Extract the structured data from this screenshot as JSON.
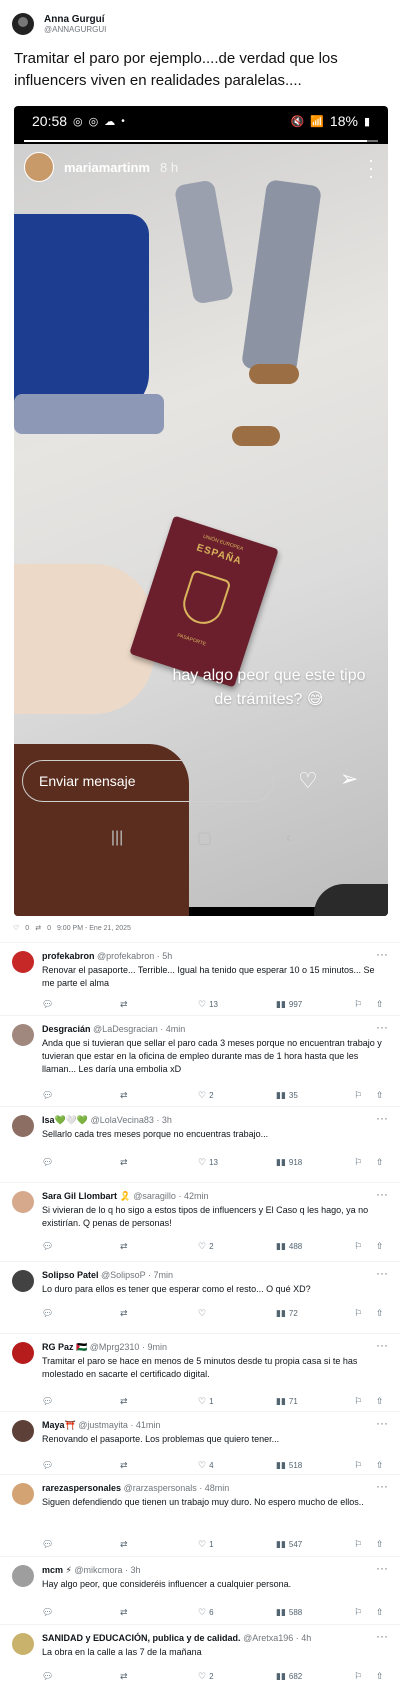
{
  "post": {
    "author_name": "Anna Gurguí",
    "author_handle": "@ANNAGURGUI",
    "text": "Tramitar el paro por ejemplo....de verdad que los influencers viven en realidades paralelas....",
    "meta": {
      "likes": "0",
      "retweets": "0",
      "datetime": "9:00 PM - Ene 21, 2025"
    }
  },
  "story": {
    "status_time": "20:58",
    "battery": "18%",
    "progress": 0.97,
    "username": "mariamartinm",
    "time": "8 h",
    "caption": "hay algo peor que este tipo de trámites? 😅",
    "message_placeholder": "Enviar mensaje",
    "passport_top": "UNIÓN EUROPEA",
    "passport_country": "ESPAÑA",
    "passport_bottom": "PASAPORTE"
  },
  "replies": [
    {
      "name": "profekabron",
      "badge": "",
      "handle": "@profekabron",
      "time": "5h",
      "text": "Renovar el pasaporte... Terrible... Igual ha tenido que esperar 10 o 15 minutos... Se me parte el alma",
      "likes": "13",
      "views": "997",
      "avatar_color": "#c62828"
    },
    {
      "name": "Desgracián",
      "badge": "",
      "handle": "@LaDesgracian",
      "time": "4min",
      "text": "Anda que si tuvieran que sellar el paro cada 3 meses porque no encuentran trabajo y tuvieran que estar en la oficina de empleo durante mas de 1 hora hasta que les llaman... Les daría una embolia xD",
      "likes": "2",
      "views": "35",
      "avatar_color": "#a1887f"
    },
    {
      "name": "Isa💚🤍💚",
      "badge": "",
      "handle": "@LolaVecina83",
      "time": "3h",
      "text": "Sellarlo cada tres meses porque no encuentras trabajo...",
      "likes": "13",
      "views": "918",
      "avatar_color": "#8d6e63"
    },
    {
      "name": "Sara Gil Llombart",
      "badge": "🎗️",
      "handle": "@saragillo",
      "time": "42min",
      "text": "Si vivieran de lo q ho sigo a estos tipos de influencers y El Caso q les hago, ya no existirían. Q penas de personas!",
      "likes": "2",
      "views": "488",
      "avatar_color": "#d7a98c"
    },
    {
      "name": "Solipso Patel",
      "badge": "",
      "handle": "@SolipsoP",
      "time": "7min",
      "text": "Lo duro para ellos es tener que esperar como el resto... O qué XD?",
      "likes": "",
      "views": "72",
      "avatar_color": "#424242"
    },
    {
      "name": "RG Paz",
      "badge": "🇵🇸",
      "handle": "@Mprg2310",
      "time": "9min",
      "text": "Tramitar el paro se hace en menos de 5 minutos desde tu propia casa si te has molestado en sacarte el certificado digital.",
      "likes": "1",
      "views": "71",
      "avatar_color": "#b71c1c"
    },
    {
      "name": "Maya⛩️",
      "badge": "",
      "handle": "@justmayita",
      "time": "41min",
      "text": "Renovando el pasaporte. Los problemas que quiero tener...",
      "likes": "4",
      "views": "518",
      "avatar_color": "#5d4037"
    },
    {
      "name": "rarezaspersonales",
      "badge": "",
      "handle": "@rarzaspersonals",
      "time": "48min",
      "text": "Siguen defendiendo que tienen un trabajo muy duro. No espero mucho de ellos..",
      "likes": "1",
      "views": "547",
      "avatar_color": "#d4a373"
    },
    {
      "name": "mcm ⚡",
      "badge": "",
      "handle": "@mikcmora",
      "time": "3h",
      "text": "Hay algo peor, que consideréis influencer a cualquier persona.",
      "likes": "6",
      "views": "588",
      "avatar_color": "#9e9e9e"
    },
    {
      "name": "SANIDAD y EDUCACIÓN, publica y de calidad.",
      "badge": "",
      "handle": "@Aretxa196",
      "time": "4h",
      "text": "La obra en la calle a las 7 de la mañana",
      "likes": "2",
      "views": "682",
      "avatar_color": "#c9b26b"
    }
  ]
}
